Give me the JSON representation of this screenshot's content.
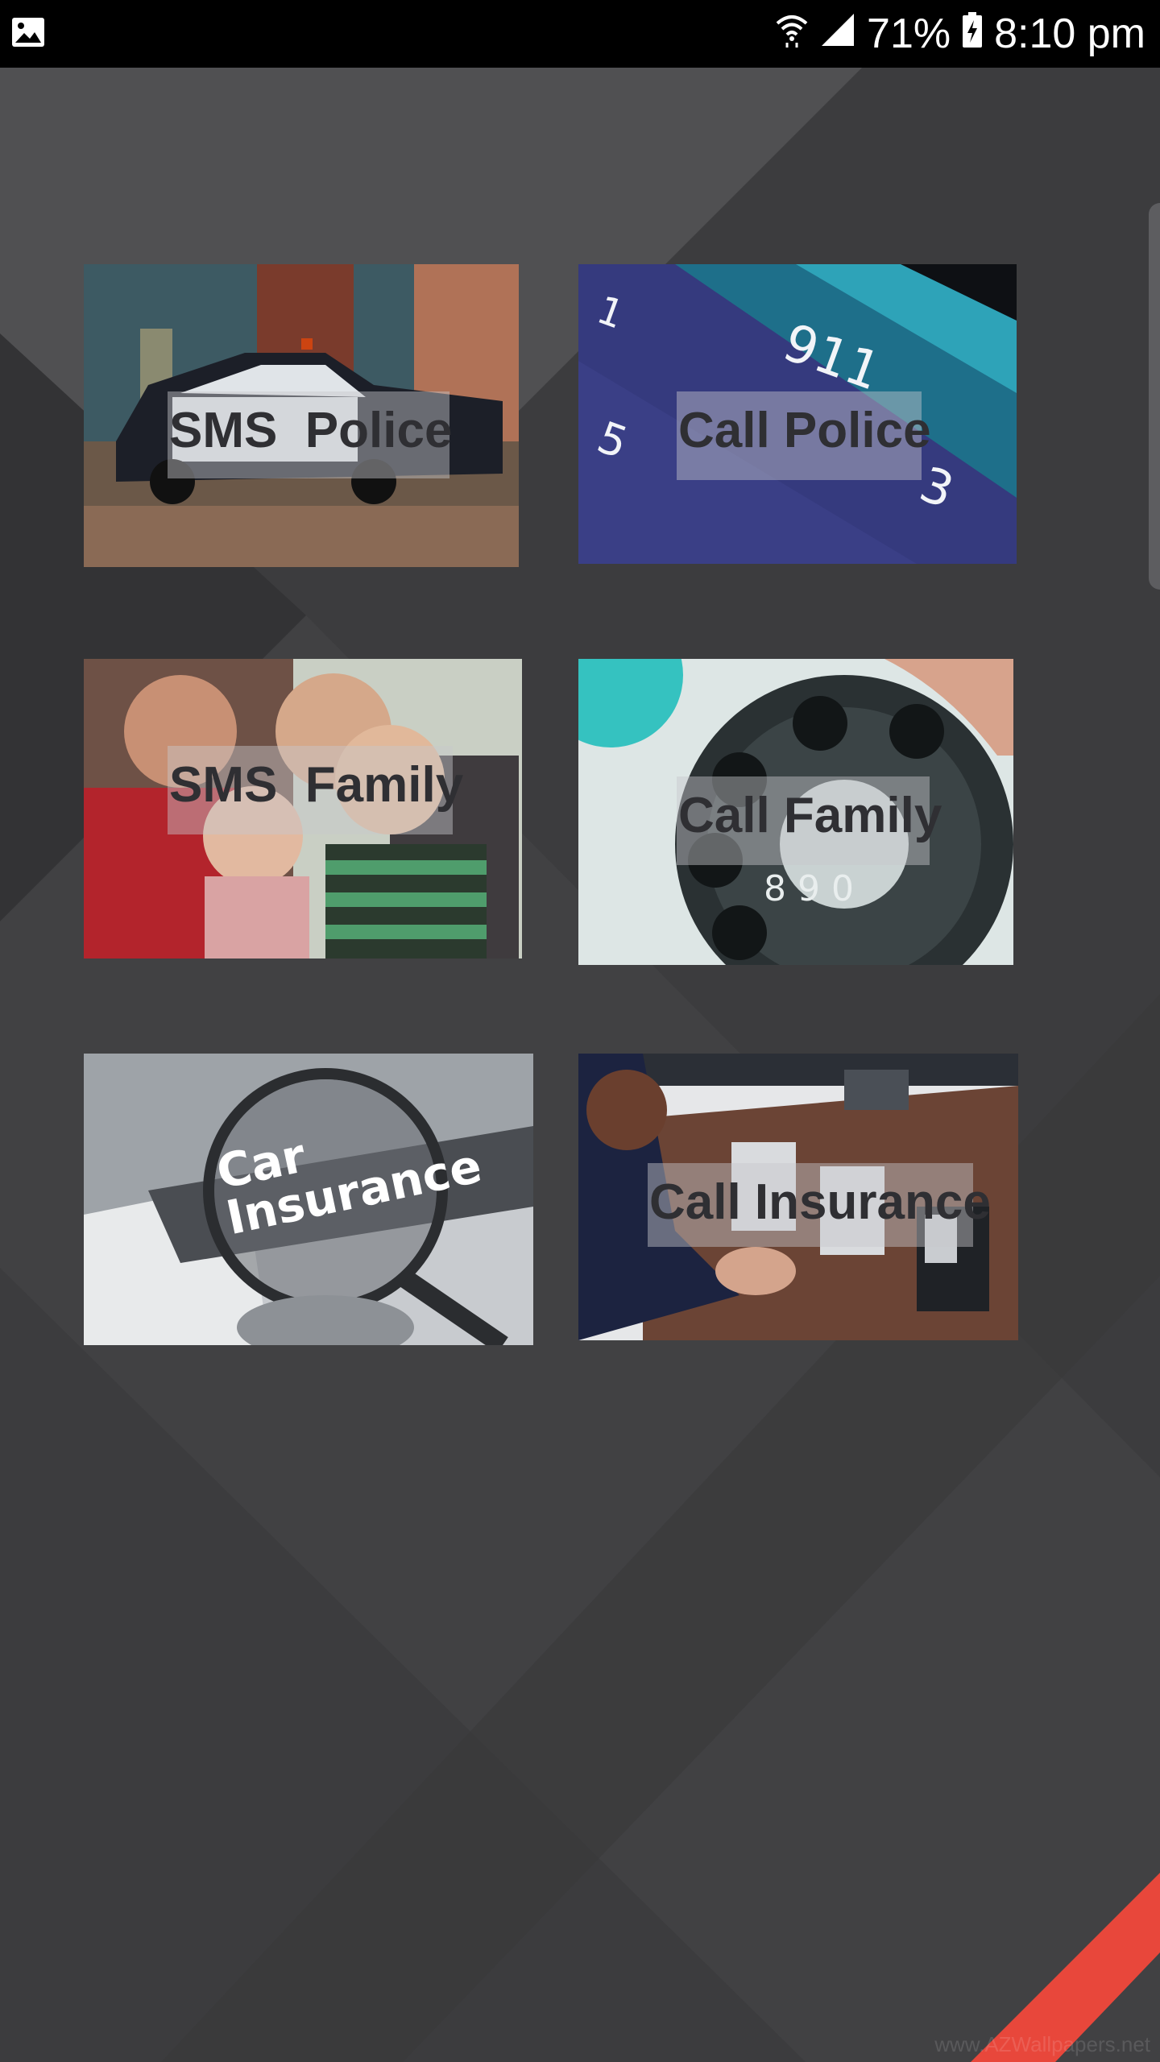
{
  "status_bar": {
    "battery_percent": "71%",
    "time": "8:10 pm",
    "icons": [
      "gallery-notification-icon",
      "wifi-icon",
      "signal-icon",
      "battery-charging-icon"
    ]
  },
  "tiles": [
    {
      "label": "SMS  Police",
      "image": "police-car-photo"
    },
    {
      "label": "Call Police",
      "image": "phone-911-keypad-photo"
    },
    {
      "label": "SMS  Family",
      "image": "family-photo"
    },
    {
      "label": "Call Family",
      "image": "rotary-phone-photo"
    },
    {
      "label": "Car\nInsurance",
      "image": "car-insurance-magnifier-photo"
    },
    {
      "label": "Call Insurance",
      "image": "office-phone-photo"
    }
  ],
  "wallpaper": {
    "watermark": "www.AZWallpapers.net",
    "accent_color": "#e8473b",
    "base_color": "#3d3d3f"
  }
}
